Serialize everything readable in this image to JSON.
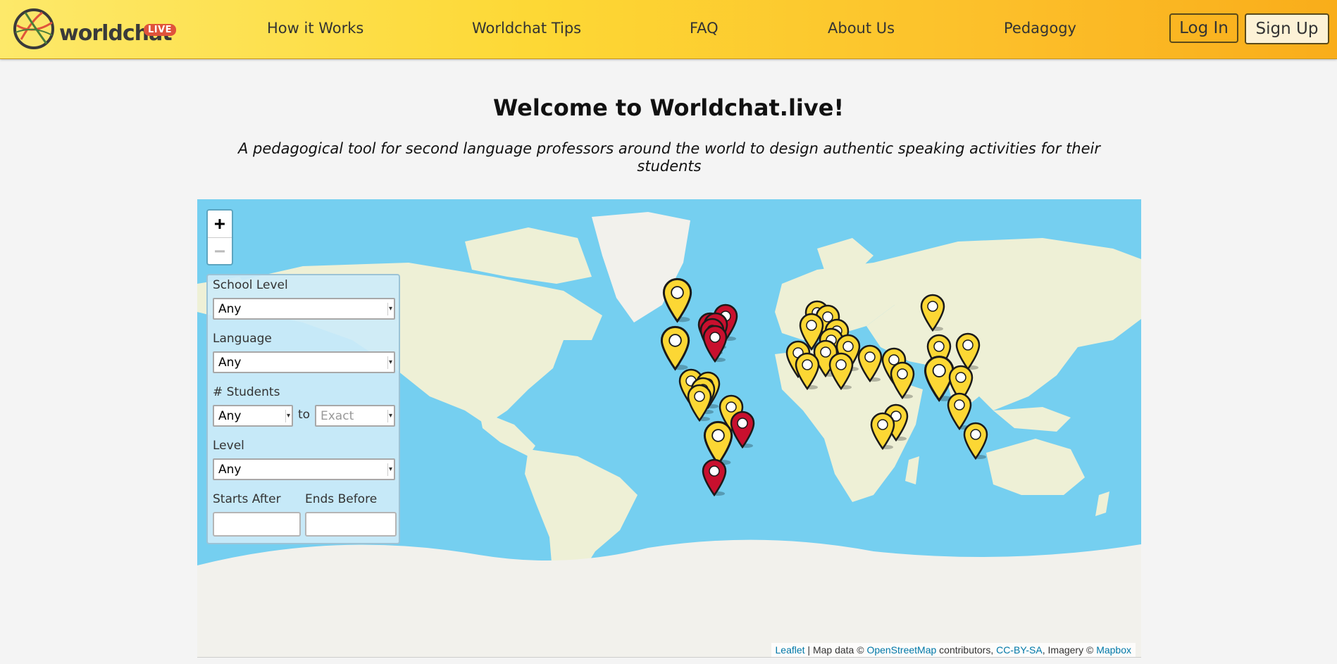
{
  "header": {
    "logo_text": "worldchat",
    "logo_badge": "LIVE",
    "nav": [
      "How it Works",
      "Worldchat Tips",
      "FAQ",
      "About Us",
      "Pedagogy"
    ],
    "login_label": "Log In",
    "signup_label": "Sign Up",
    "colors": {
      "bar_start": "#fde96a",
      "bar_end": "#f9ad1a",
      "badge": "#e0533b"
    }
  },
  "hero": {
    "title": "Welcome to Worldchat.live!",
    "subtitle": "A pedagogical tool for second language professors around the world to design authentic speaking activities for their students"
  },
  "map": {
    "zoom_in": "+",
    "zoom_out": "−",
    "colors": {
      "water": "#75cff0",
      "land": "#eef0d6",
      "ice": "#f2f1ec",
      "marker_yellow": "#fcd734",
      "marker_red": "#c8102e"
    },
    "filters": {
      "school_level": {
        "label": "School Level",
        "value": "Any"
      },
      "language": {
        "label": "Language",
        "value": "Any"
      },
      "students": {
        "label": "# Students",
        "from_value": "Any",
        "to_text": "to",
        "to_placeholder": "Exact"
      },
      "level": {
        "label": "Level",
        "value": "Any"
      },
      "starts_after": {
        "label": "Starts After",
        "value": ""
      },
      "ends_before": {
        "label": "Ends Before",
        "value": ""
      }
    },
    "attribution": {
      "leaflet": "Leaflet",
      "sep1": " | Map data © ",
      "osm": "OpenStreetMap",
      "sep2": " contributors, ",
      "license": "CC-BY-SA",
      "sep3": ", Imagery © ",
      "mapbox": "Mapbox"
    }
  }
}
